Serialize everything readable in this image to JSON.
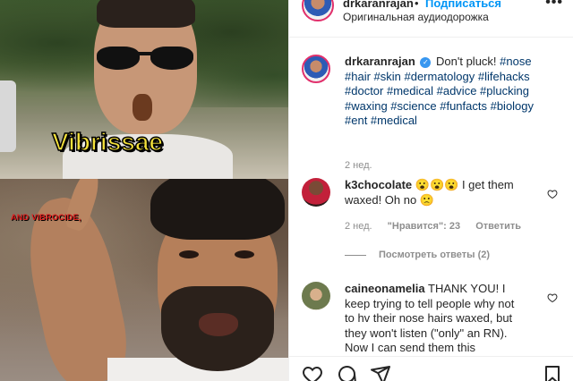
{
  "media": {
    "caption_top": "Vibrissae",
    "caption_bottom": "AND VIBROCIDE,"
  },
  "header": {
    "username": "drkaranrajan",
    "dot": "•",
    "follow_label": "Подписаться",
    "audio_label": "Оригинальная аудиодорожка",
    "more_label": "•••"
  },
  "caption": {
    "username": "drkaranrajan",
    "text_plain": "Don't pluck!",
    "hashtags": [
      "#nose",
      "#hair",
      "#skin",
      "#dermatology",
      "#lifehacks",
      "#doctor",
      "#medical",
      "#advice",
      "#plucking",
      "#waxing",
      "#science",
      "#funfacts",
      "#biology",
      "#ent",
      "#medical"
    ],
    "line1_tags": "#nose",
    "line2": "#hair #skin #dermatology #lifehacks",
    "line3": "#doctor #medical #advice #plucking",
    "line4": "#waxing #science #funfacts #biology",
    "line5": "#ent #medical",
    "time": "2 нед."
  },
  "comments": [
    {
      "username": "k3chocolate",
      "text_line1": "😮😮😮 I get them",
      "text_line2": "waxed! Oh no 🙁",
      "time": "2 нед.",
      "likes": "\"Нравится\": 23",
      "reply_label": "Ответить",
      "view_replies": "Посмотреть ответы (2)"
    },
    {
      "username": "caineonamelia",
      "text_line1": "THANK YOU! I",
      "text_line2": "keep trying to tell people why not",
      "text_line3": "to hv their nose hairs waxed, but",
      "text_line4": "they won't listen (\"only\" an RN).",
      "text_line5": "Now I can send them this"
    }
  ],
  "colors": {
    "link_blue": "#0095f6",
    "hashtag": "#00376b",
    "meta_gray": "#8e8e8e",
    "caption_yellow": "#f4e13b",
    "caption_red": "#e01d1d"
  },
  "icons": [
    "heart-icon",
    "comment-icon",
    "share-icon",
    "bookmark-icon",
    "verified-icon",
    "more-icon"
  ]
}
